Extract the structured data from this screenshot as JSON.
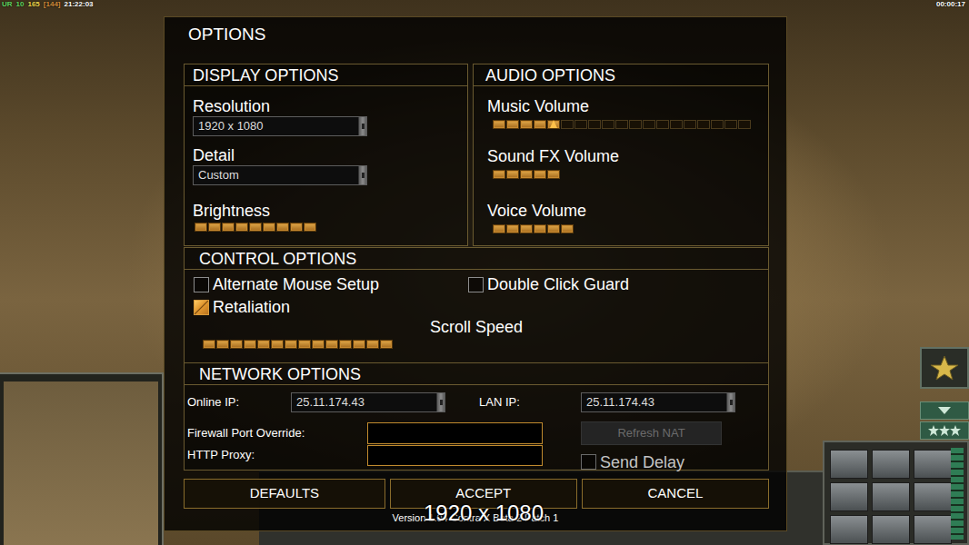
{
  "hud": {
    "stats": [
      {
        "text": "UR",
        "color": "#5fd35f"
      },
      {
        "text": "10",
        "color": "#5fd35f"
      },
      {
        "text": "165",
        "color": "#e8d44a"
      },
      {
        "text": "[144]",
        "color": "#d08a3a"
      },
      {
        "text": "21:22:03",
        "color": "#ffffff"
      }
    ],
    "timer": "00:00:17"
  },
  "dialog": {
    "title": "OPTIONS",
    "display": {
      "heading": "DISPLAY OPTIONS",
      "resolution": {
        "label": "Resolution",
        "value": "1920 x 1080"
      },
      "detail": {
        "label": "Detail",
        "value": "Custom"
      },
      "brightness": {
        "label": "Brightness",
        "level": 0.47,
        "focused": false
      }
    },
    "audio": {
      "heading": "AUDIO OPTIONS",
      "sliders": [
        {
          "label": "Music Volume",
          "level": 0.26,
          "focused": true
        },
        {
          "label": "Sound FX Volume",
          "level": 0.26,
          "focused": false
        },
        {
          "label": "Voice Volume",
          "level": 0.32,
          "focused": false
        }
      ]
    },
    "controls": {
      "heading": "CONTROL OPTIONS",
      "checkboxes": [
        {
          "label": "Alternate Mouse Setup",
          "checked": false
        },
        {
          "label": "Double Click Guard",
          "checked": false
        },
        {
          "label": "Retaliation",
          "checked": true
        }
      ],
      "scroll_speed": {
        "label": "Scroll Speed",
        "level": 0.74,
        "focused": false
      }
    },
    "network": {
      "heading": "NETWORK OPTIONS",
      "online_ip": {
        "label": "Online IP:",
        "value": "25.11.174.43"
      },
      "lan_ip": {
        "label": "LAN IP:",
        "value": "25.11.174.43"
      },
      "firewall_port": {
        "label": "Firewall Port Override:",
        "value": ""
      },
      "http_proxy": {
        "label": "HTTP Proxy:",
        "value": ""
      },
      "refresh_nat": {
        "label": "Refresh NAT",
        "disabled": true
      },
      "send_delay": {
        "label": "Send Delay",
        "checked": false,
        "disabled": true
      }
    },
    "buttons": [
      "DEFAULTS",
      "ACCEPT",
      "CANCEL"
    ],
    "version": "Version 1.04 Contra X Beta 2 Patch 1",
    "resolution_notice": "1920 x 1080"
  }
}
